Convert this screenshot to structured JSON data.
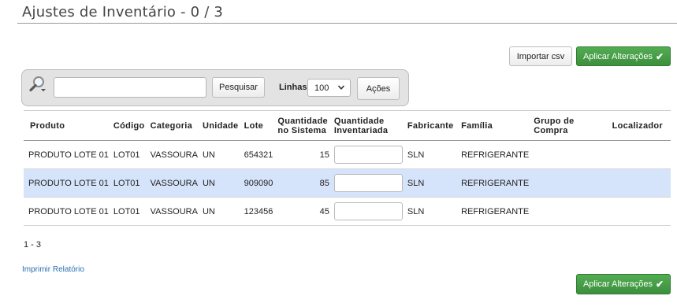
{
  "page": {
    "title": "Ajustes de Inventário - 0 / 3"
  },
  "toolbar": {
    "import_label": "Importar csv",
    "apply_label": "Aplicar Alterações"
  },
  "search": {
    "placeholder": "",
    "value": "",
    "button_label": "Pesquisar",
    "rows_label": "Linhas",
    "rows_value": "100",
    "actions_label": "Ações"
  },
  "table": {
    "headers": {
      "produto": "Produto",
      "codigo": "Código",
      "categoria": "Categoria",
      "unidade": "Unidade",
      "lote": "Lote",
      "qtd_sistema_1": "Quantidade",
      "qtd_sistema_2": "no Sistema",
      "qtd_inventariada_1": "Quantidade",
      "qtd_inventariada_2": "Inventariada",
      "fabricante": "Fabricante",
      "familia": "Família",
      "grupo_compra": "Grupo de Compra",
      "localizador": "Localizador"
    },
    "rows": [
      {
        "produto": "PRODUTO LOTE 01",
        "codigo": "LOT01",
        "categoria": "VASSOURA",
        "unidade": "UN",
        "lote": "654321",
        "qtd_sistema": "15",
        "qtd_inventariada": "",
        "fabricante": "SLN",
        "familia": "REFRIGERANTE",
        "grupo_compra": "",
        "localizador": ""
      },
      {
        "produto": "PRODUTO LOTE 01",
        "codigo": "LOT01",
        "categoria": "VASSOURA",
        "unidade": "UN",
        "lote": "909090",
        "qtd_sistema": "85",
        "qtd_inventariada": "",
        "fabricante": "SLN",
        "familia": "REFRIGERANTE",
        "grupo_compra": "",
        "localizador": ""
      },
      {
        "produto": "PRODUTO LOTE 01",
        "codigo": "LOT01",
        "categoria": "VASSOURA",
        "unidade": "UN",
        "lote": "123456",
        "qtd_sistema": "45",
        "qtd_inventariada": "",
        "fabricante": "SLN",
        "familia": "REFRIGERANTE",
        "grupo_compra": "",
        "localizador": ""
      }
    ]
  },
  "pager": {
    "range": "1 - 3"
  },
  "footer": {
    "print_report": "Imprimir Relatório",
    "apply_label": "Aplicar Alterações"
  },
  "icons": {
    "search": "magnifier-icon",
    "check": "check-icon",
    "dropdown": "chevron-down-icon"
  },
  "colors": {
    "accent_green": "#46a046",
    "selected_row": "#d6e4fb",
    "link": "#2a6fb0"
  }
}
